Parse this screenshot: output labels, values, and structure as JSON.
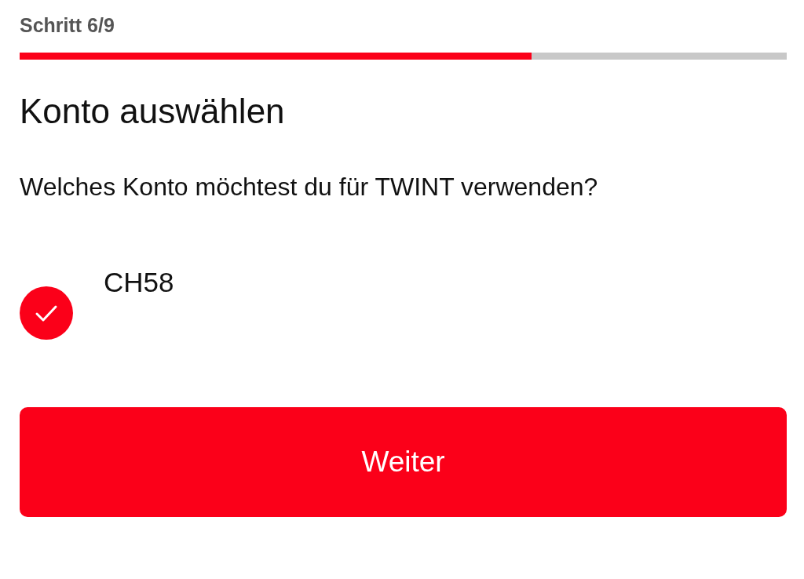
{
  "step": {
    "label": "Schritt 6/9",
    "level": 0.667
  },
  "title": "Konto auswählen",
  "question": "Welches Konto möchtest du für TWINT verwenden?",
  "accounts": [
    {
      "label": "CH58",
      "selected": true
    }
  ],
  "button": "Weiter"
}
